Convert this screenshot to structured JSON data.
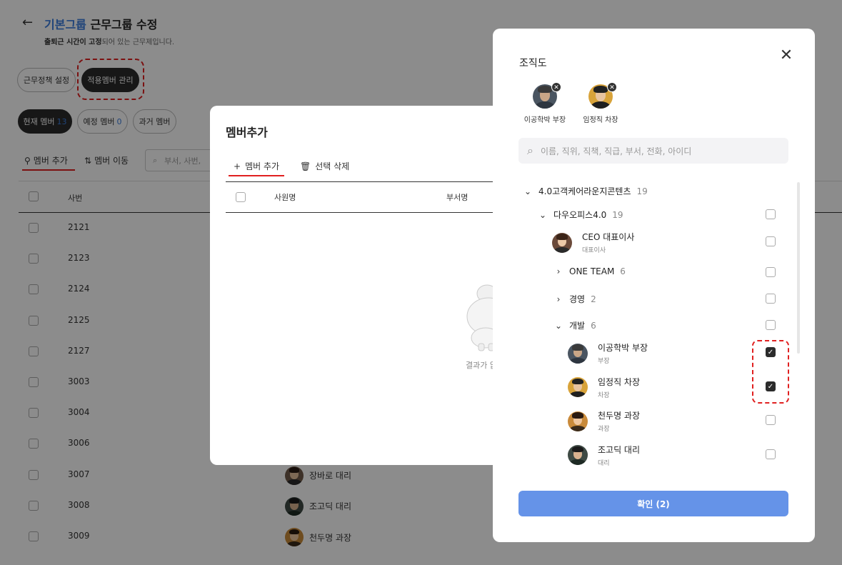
{
  "header": {
    "title_blue": "기본그룹",
    "title_rest": "근무그룹 수정",
    "subtitle_bold": "출퇴근 시간이 고정",
    "subtitle_rest": "되어 있는 근무제입니다."
  },
  "tabs": {
    "policy": "근무정책 설정",
    "members": "적용멤버 관리"
  },
  "member_filters": [
    {
      "label": "현재 멤버",
      "count": "13"
    },
    {
      "label": "예정 멤버",
      "count": "0"
    },
    {
      "label": "과거 멤버",
      "count": ""
    }
  ],
  "toolbar": {
    "add": "멤버 추가",
    "move": "멤버 이동",
    "search_placeholder": "부서, 사번, "
  },
  "table": {
    "col_id": "사번",
    "rows": [
      {
        "id": "2121",
        "member": ""
      },
      {
        "id": "2123",
        "member": ""
      },
      {
        "id": "2124",
        "member": ""
      },
      {
        "id": "2125",
        "member": ""
      },
      {
        "id": "2127",
        "member": ""
      },
      {
        "id": "3003",
        "member": ""
      },
      {
        "id": "3004",
        "member": ""
      },
      {
        "id": "3006",
        "member": ""
      },
      {
        "id": "3007",
        "member": "장바로 대리"
      },
      {
        "id": "3008",
        "member": "조고딕 대리"
      },
      {
        "id": "3009",
        "member": "천두명 과장"
      }
    ]
  },
  "add_modal": {
    "title": "멤버추가",
    "add_tab": "멤버 추가",
    "delete_tab": "선택 삭제",
    "col_name": "사원명",
    "col_dept": "부서명",
    "empty_text": "결과가 없"
  },
  "org_panel": {
    "title": "조직도",
    "selected": [
      {
        "name": "이공학박 부장"
      },
      {
        "name": "임정직 차장"
      }
    ],
    "search_placeholder": "이름, 직위, 직책, 직급, 부서, 전화, 아이디",
    "tree": {
      "root": {
        "name": "4.0고객케어라운지콘텐츠",
        "count": "19"
      },
      "office": {
        "name": "다우오피스4.0",
        "count": "19"
      },
      "ceo": {
        "name": "CEO 대표이사",
        "role": "대표이사"
      },
      "one_team": {
        "name": "ONE TEAM",
        "count": "6"
      },
      "mgmt": {
        "name": "경영",
        "count": "2"
      },
      "dev": {
        "name": "개발",
        "count": "6"
      },
      "people": [
        {
          "name": "이공학박 부장",
          "role": "부장",
          "checked": true
        },
        {
          "name": "임정직 차장",
          "role": "차장",
          "checked": true
        },
        {
          "name": "천두명 과장",
          "role": "과장",
          "checked": false
        },
        {
          "name": "조고딕 대리",
          "role": "대리",
          "checked": false
        }
      ]
    },
    "confirm": "확인 (2)"
  },
  "colors": {
    "accent": "#3b7ddd",
    "confirm_button": "#6593e8",
    "highlight": "#e02020",
    "dark": "#2b2b2b"
  }
}
